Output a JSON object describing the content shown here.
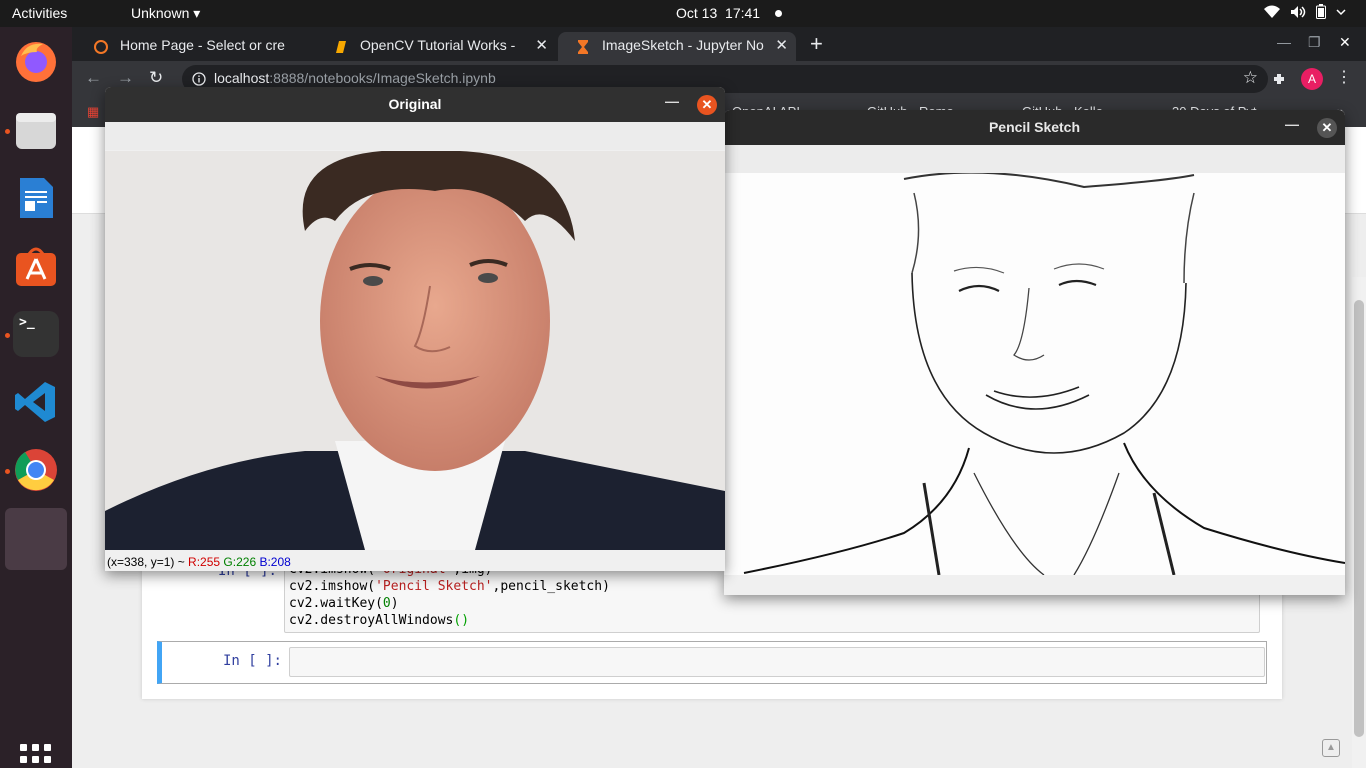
{
  "topbar": {
    "activities": "Activities",
    "app_menu": "Unknown ▾",
    "date": "Oct 13",
    "time": "17:41"
  },
  "dock": {
    "apps": [
      "firefox-icon",
      "files-icon",
      "writer-icon",
      "software-icon",
      "terminal-icon",
      "vscode-icon",
      "chrome-icon",
      "blank-app-icon"
    ],
    "terminal_glyph": ">_"
  },
  "browser": {
    "tabs": [
      {
        "label": "Home Page - Select or cre"
      },
      {
        "label": "OpenCV Tutorial Works -"
      },
      {
        "label": "ImageSketch - Jupyter No"
      }
    ],
    "url_host": "localhost",
    "url_path": ":8888/notebooks/ImageSketch.ipynb",
    "profile_initial": "A",
    "bookmarks": [
      "OpenAI API",
      "GitHub - Remo...",
      "GitHub - Kelle...",
      "30 Days of Pyt..."
    ]
  },
  "notebook": {
    "cell1_prompt": "In [ ]:",
    "cell1_lines": {
      "line1_pre": "cv2.imshow(",
      "line1_str": "'Original'",
      "line1_post": ",img)",
      "line2_pre": "cv2.imshow(",
      "line2_str": "'Pencil Sketch'",
      "line2_post": ",pencil_sketch)",
      "line3_pre": "cv2.waitKey(",
      "line3_num": "0",
      "line3_post": ")",
      "line4_pre": "cv2.destroyAllWindows",
      "line4_paren": "()"
    },
    "cell2_prompt": "In [ ]:"
  },
  "original_window": {
    "title": "Original",
    "status_prefix": "(x=338, y=1) ~ ",
    "r": "R:255",
    "g": "G:226",
    "b": "B:208"
  },
  "sketch_window": {
    "title": "Pencil Sketch"
  },
  "colors": {
    "ubuntu_orange": "#e95420",
    "profile": "#e91e63",
    "cell_selected": "#42a5f5"
  }
}
